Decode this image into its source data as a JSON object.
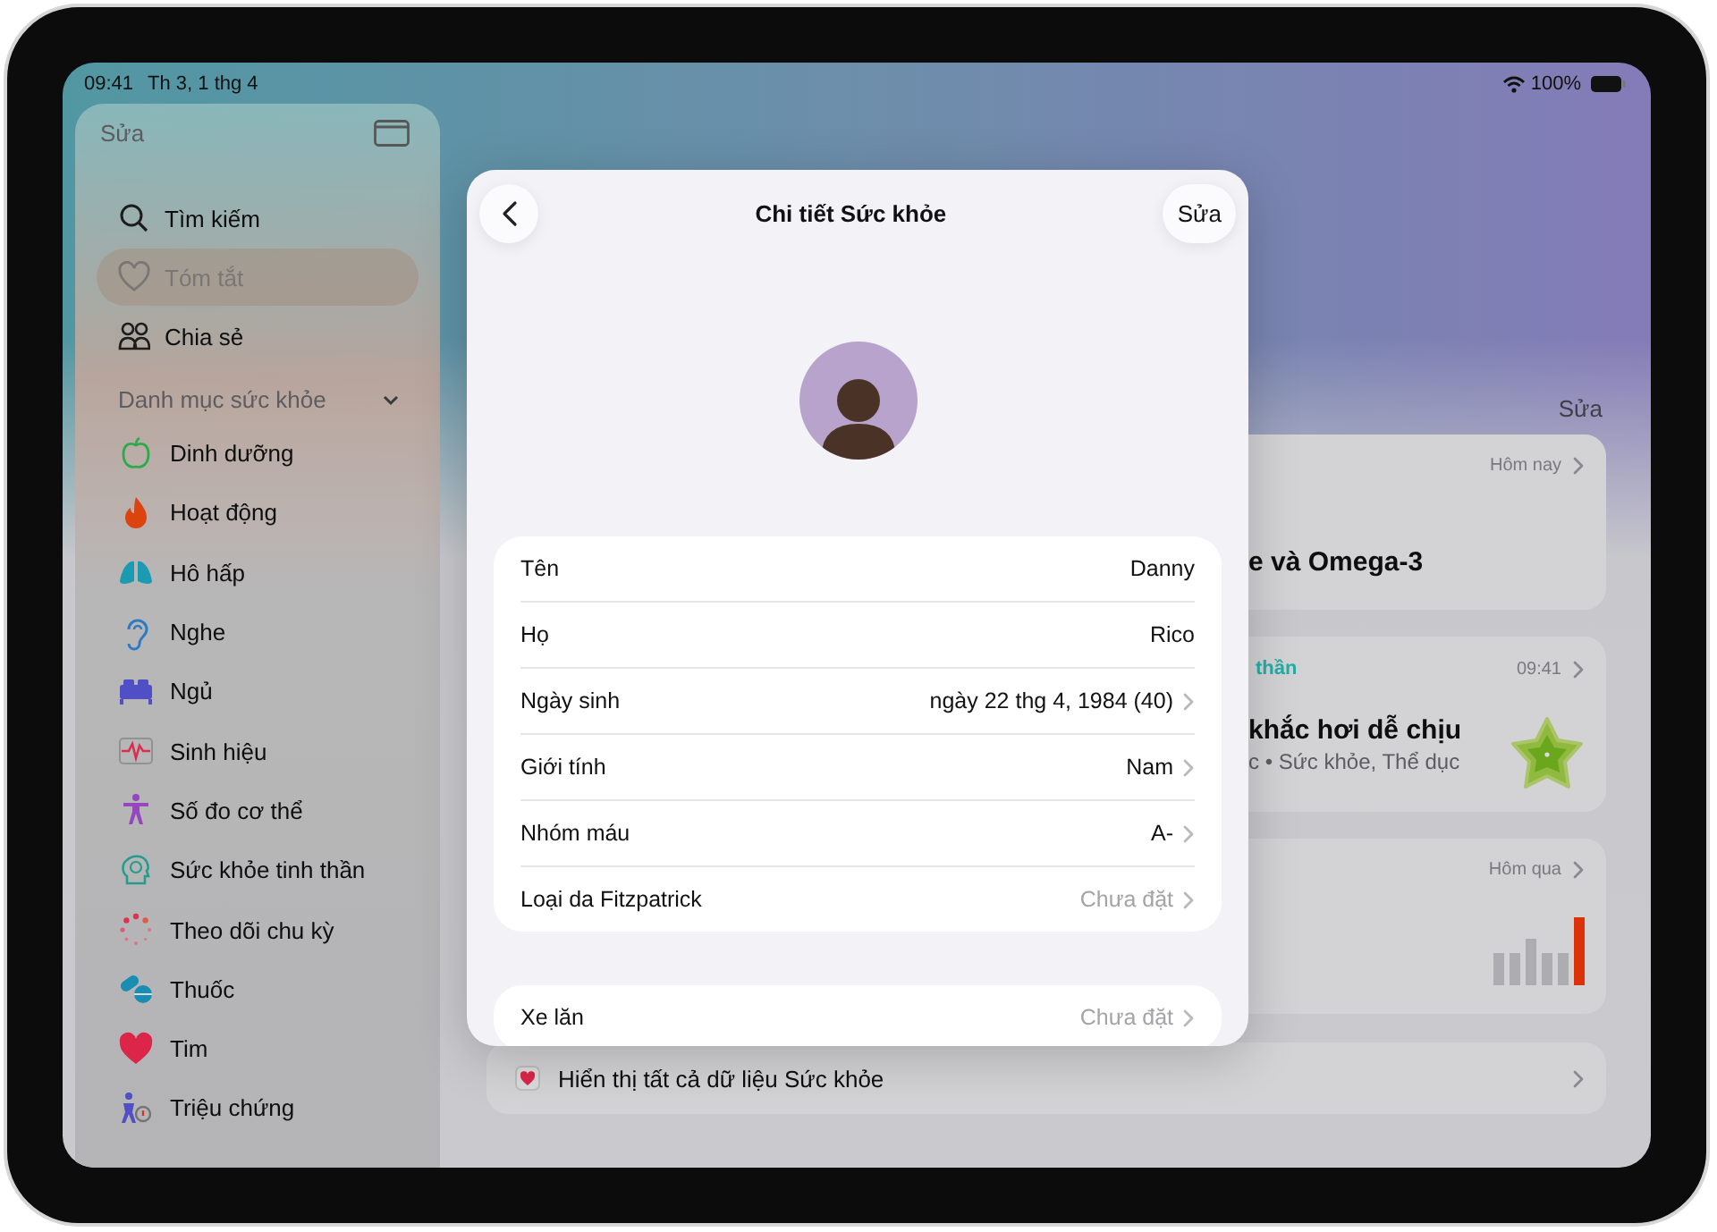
{
  "status_bar": {
    "time": "09:41",
    "date": "Th 3, 1 thg 4",
    "battery": "100%"
  },
  "sidebar": {
    "edit": "Sửa",
    "items": [
      {
        "label": "Tìm kiếm",
        "selected": false
      },
      {
        "label": "Tóm tắt",
        "selected": true
      },
      {
        "label": "Chia sẻ",
        "selected": false
      }
    ],
    "section": {
      "title": "Danh mục sức khỏe",
      "expanded": true
    },
    "categories": [
      "Dinh dưỡng",
      "Hoạt động",
      "Hô hấp",
      "Nghe",
      "Ngủ",
      "Sinh hiệu",
      "Số đo cơ thể",
      "Sức khỏe tinh thần",
      "Theo dõi chu kỳ",
      "Thuốc",
      "Tim",
      "Triệu chứng"
    ]
  },
  "main": {
    "edit": "Sửa",
    "cards": [
      {
        "kind": "plain",
        "time": "Hôm nay",
        "title": "e và Omega-3"
      },
      {
        "kind": "mood",
        "category": "thần",
        "time": "09:41",
        "title": "khắc hơi dễ chịu",
        "subtitle": "c • Sức khỏe, Thể dục"
      },
      {
        "kind": "bars",
        "time": "Hôm qua"
      }
    ],
    "show_all": "Hiển thị tất cả dữ liệu Sức khỏe"
  },
  "sheet": {
    "title": "Chi tiết Sức khỏe",
    "edit": "Sửa",
    "groups": [
      [
        {
          "label": "Tên",
          "value": "Danny",
          "chevron": false,
          "muted": false
        },
        {
          "label": "Họ",
          "value": "Rico",
          "chevron": false,
          "muted": false
        },
        {
          "label": "Ngày sinh",
          "value": "ngày 22 thg 4, 1984 (40)",
          "chevron": true,
          "muted": false
        },
        {
          "label": "Giới tính",
          "value": "Nam",
          "chevron": true,
          "muted": false
        },
        {
          "label": "Nhóm máu",
          "value": "A-",
          "chevron": true,
          "muted": false
        },
        {
          "label": "Loại da Fitzpatrick",
          "value": "Chưa đặt",
          "chevron": true,
          "muted": true
        }
      ],
      [
        {
          "label": "Xe lăn",
          "value": "Chưa đặt",
          "chevron": true,
          "muted": true
        }
      ]
    ]
  }
}
